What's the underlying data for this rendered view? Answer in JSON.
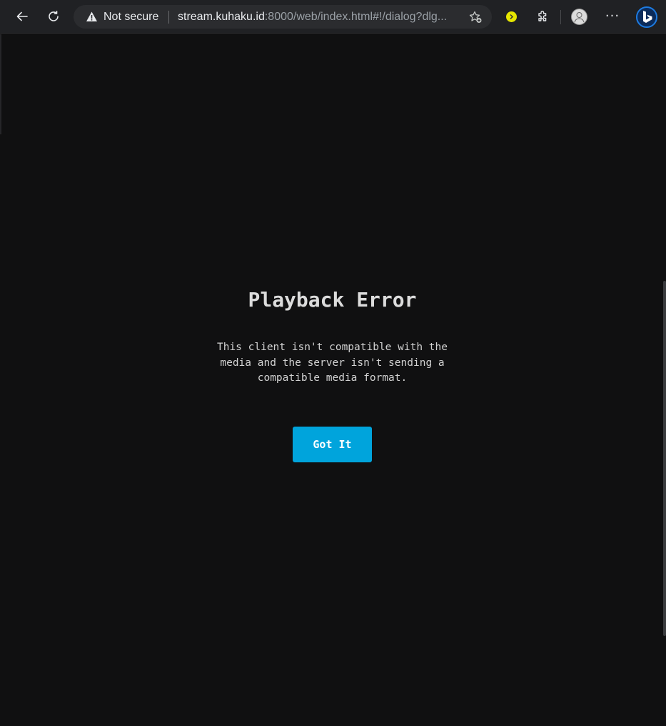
{
  "browser": {
    "security_label": "Not secure",
    "url_host": "stream.kuhaku.id",
    "url_rest": ":8000/web/index.html#!/dialog?dlg...",
    "icons": {
      "back": "back-arrow-icon",
      "reload": "reload-icon",
      "warning": "warning-icon",
      "favorite": "add-favorite-icon",
      "extension": "extension-icon",
      "extensions_menu": "puzzle-icon",
      "profile": "profile-avatar-icon",
      "more": "more-options-icon",
      "bing": "bing-copilot-icon"
    },
    "more_label": "···"
  },
  "dialog": {
    "title": "Playback Error",
    "message": "This client isn't compatible with the media and the server isn't sending a compatible media format.",
    "button_label": "Got It"
  },
  "colors": {
    "background": "#101011",
    "accent": "#00a4dc",
    "chrome": "#202124"
  }
}
